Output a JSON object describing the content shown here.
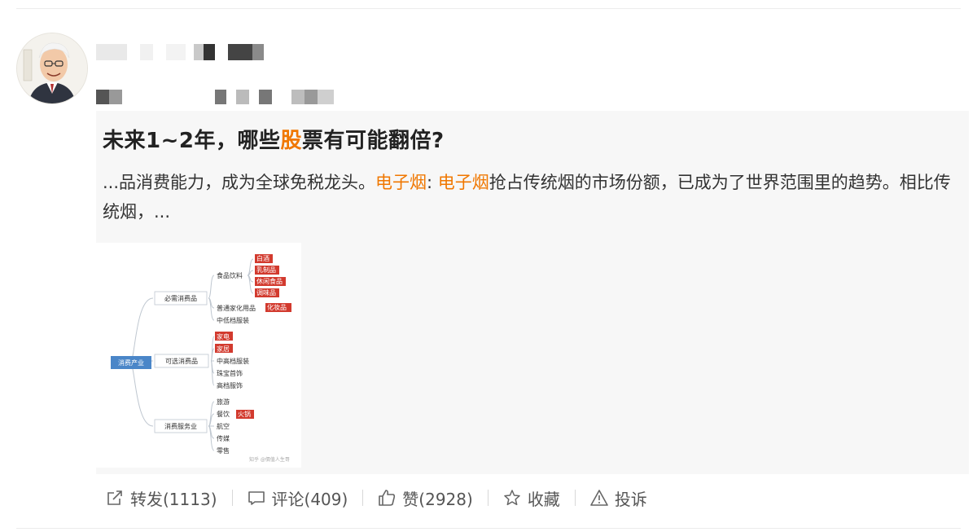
{
  "post": {
    "title_before": "未来1~2年，哪些",
    "title_highlight": "股",
    "title_after": "票有可能翻倍?",
    "excerpt_1": "...品消费能力，成为全球免税龙头。",
    "excerpt_hl_1": "电子烟",
    "excerpt_2": ": ",
    "excerpt_hl_2": "电子烟",
    "excerpt_3": "抢占传统烟的市场份额，已成为了世界范围里的趋势。相比传统烟，..."
  },
  "mindmap": {
    "root": "消费产业",
    "branches": [
      "必需消费品",
      "可选消费品",
      "消费服务业"
    ],
    "nodes_essential": [
      "食品饮料",
      "普通家化用品",
      "中低档服装"
    ],
    "food_items": [
      "白酒",
      "乳制品",
      "休闲食品",
      "调味品"
    ],
    "household_item": "化妆品",
    "optional_items": [
      "家电",
      "家居",
      "中高档服装",
      "珠宝首饰",
      "高档服饰"
    ],
    "service_items": [
      "旅游",
      "餐饮",
      "航空",
      "传媒",
      "零售"
    ],
    "catering_item": "火锅",
    "watermark": "知乎 @價值人生哥"
  },
  "actions": {
    "repost": "转发(1113)",
    "comment": "评论(409)",
    "like": "赞(2928)",
    "favorite": "收藏",
    "report": "投诉"
  },
  "colors": {
    "highlight": "#f07700",
    "tag_red": "#d23a2e",
    "root_blue": "#4a86c8"
  }
}
